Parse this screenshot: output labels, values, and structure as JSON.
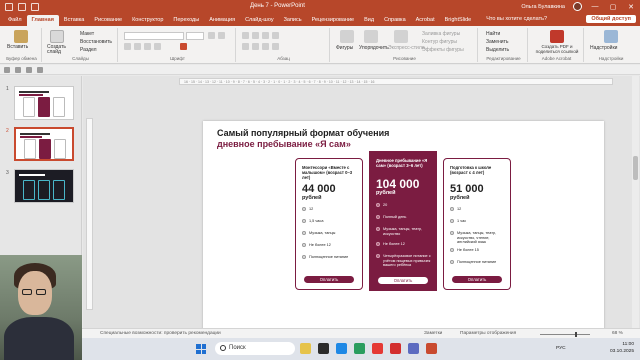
{
  "window": {
    "title": "День 7  -  PowerPoint",
    "user_name": "Ольга Булавкина",
    "minimize": "—",
    "maximize": "▢",
    "close": "✕"
  },
  "tabs": [
    "Файл",
    "Главная",
    "Вставка",
    "Рисование",
    "Конструктор",
    "Переходы",
    "Анимация",
    "Слайд-шоу",
    "Запись",
    "Рецензирование",
    "Вид",
    "Справка",
    "Acrobat",
    "BrightSlide"
  ],
  "active_tab": "Главная",
  "tell_me": "Что вы хотите сделать?",
  "share_label": "Общий доступ",
  "ribbon": {
    "clipboard": {
      "paste": "Вставить",
      "label": "Буфер обмена"
    },
    "slides": {
      "new_slide": "Создать слайд",
      "layout": "Макет",
      "reset": "Восстановить",
      "section": "Раздел",
      "label": "Слайды"
    },
    "font": {
      "label": "Шрифт"
    },
    "paragraph": {
      "label": "Абзац"
    },
    "drawing": {
      "shapes": "Фигуры",
      "arrange": "Упорядочить",
      "quick_styles": "Экспресс-стили",
      "fill": "Заливка фигуры",
      "outline": "Контур фигуры",
      "effects": "Эффекты фигуры",
      "label": "Рисование"
    },
    "editing": {
      "find": "Найти",
      "replace": "Заменить",
      "select": "Выделить",
      "label": "Редактирование"
    },
    "acrobat": {
      "create_pdf": "Создать PDF и поделиться ссылкой",
      "label": "Adobe Acrobat"
    },
    "addins": {
      "addins": "Надстройки",
      "label": "Надстройки"
    }
  },
  "ruler_text": "16 · 15 · 14 · 13 · 12 · 11 · 10 · 9 · 8 · 7 · 6 · 5 · 4 · 3 · 2 · 1 · 0 · 1 · 2 · 3 · 4 · 5 · 6 · 7 · 8 · 9 · 10 · 11 · 12 · 13 · 14 · 15 · 16",
  "thumbnails": [
    {
      "number": "1"
    },
    {
      "number": "2"
    },
    {
      "number": "3"
    }
  ],
  "slide": {
    "title_line1": "Самый популярный формат обучения",
    "title_line2": "дневное пребывание «Я сам»",
    "cards": [
      {
        "name": "Монтессори «Вместе с малышом» (возраст 0–3 лет)",
        "price": "44 000",
        "unit": "рублей",
        "features": [
          "12",
          "1,5 часа",
          "Музыка, танцы",
          "Не более 12",
          "Полноценное питание"
        ],
        "pay": "Оплатить"
      },
      {
        "name": "Дневное пребывание «Я сам» (возраст 3–6 лет)",
        "price": "104 000",
        "unit": "рублей",
        "features": [
          "20",
          "Полный день",
          "Музыка, танцы, театр, искусство",
          "Не более 12",
          "Четырёхразовое питание с учётом пищевых привычек вашего ребёнка"
        ],
        "pay": "Оплатить"
      },
      {
        "name": "Подготовка к школе (возраст с 4 лет)",
        "price": "51 000",
        "unit": "рублей",
        "features": [
          "12",
          "1 час",
          "Музыка, танцы, театр, искусство, чтение, английский язык",
          "Не более 15",
          "Полноценное питание"
        ],
        "pay": "Оплатить"
      }
    ]
  },
  "status": {
    "accessibility": "Специальные возможности: проверить рекомендации",
    "notes": "Заметки",
    "display_settings": "Параметры отображения",
    "zoom": "68 %"
  },
  "taskbar": {
    "search_placeholder": "Поиск",
    "language": "РУС",
    "time": "11:00",
    "date": "03.10.2025"
  },
  "colors": {
    "brand": "#b7472a",
    "accent": "#7b1c41"
  }
}
